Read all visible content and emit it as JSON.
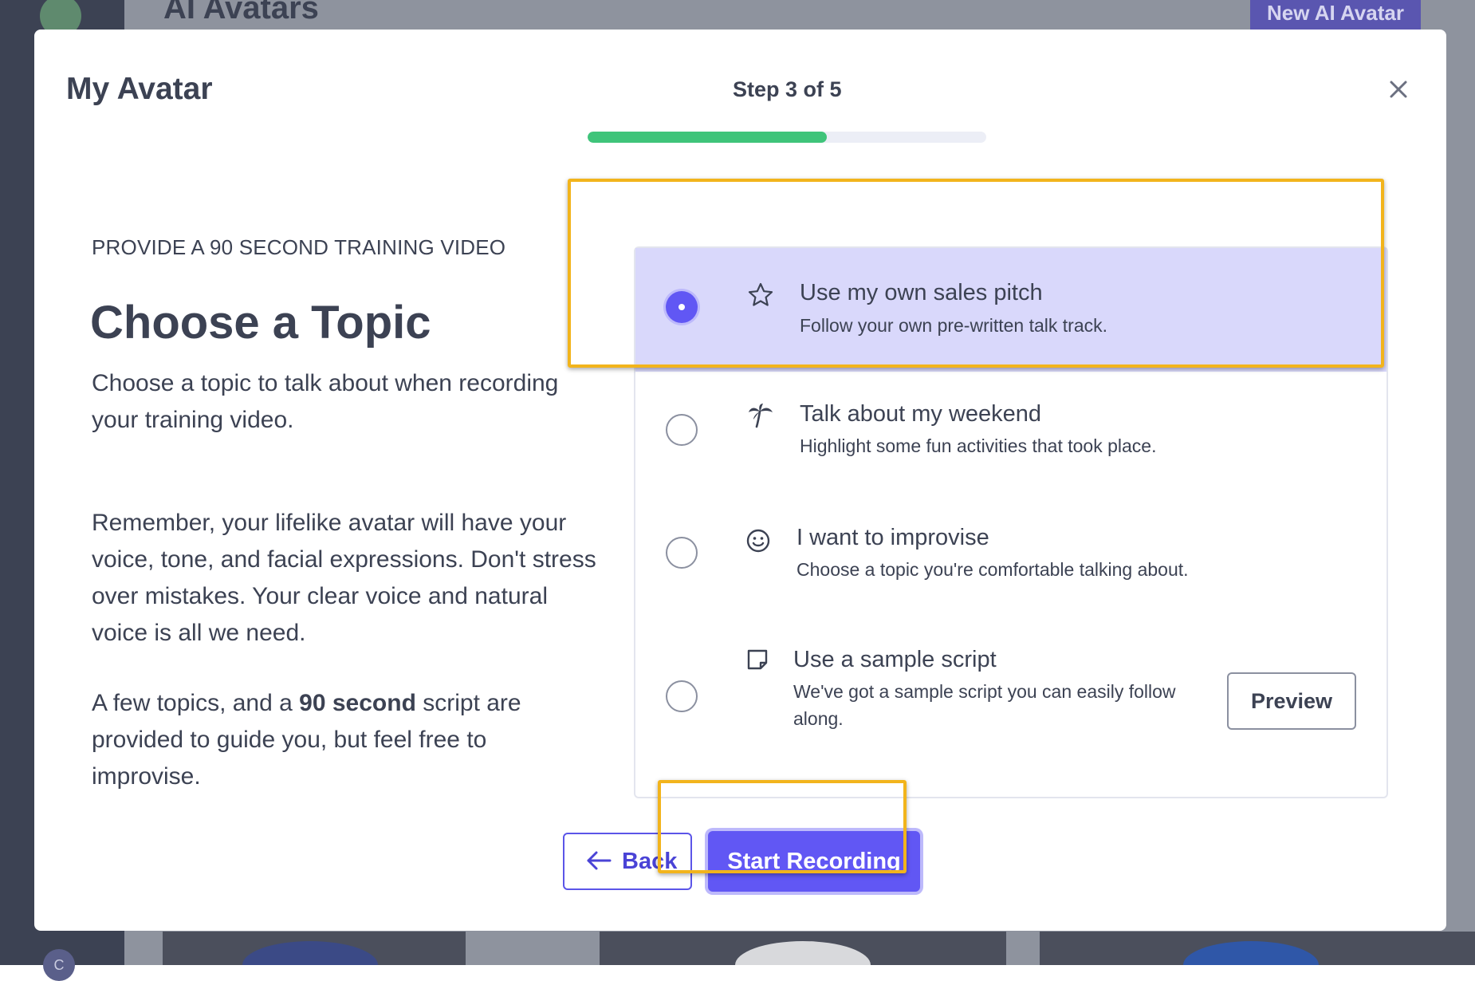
{
  "background_app": {
    "title": "AI Avatars",
    "new_button_label": "New AI Avatar",
    "sidebar_avatar_initial": "C"
  },
  "modal": {
    "title": "My Avatar",
    "step_label": "Step 3 of 5",
    "progress_fraction": 0.6,
    "close_icon": "close-icon"
  },
  "intro": {
    "eyebrow": "PROVIDE A 90 SECOND TRAINING VIDEO",
    "heading": "Choose a Topic",
    "paragraph1": "Choose a topic to talk about when recording your training video.",
    "paragraph2": "Remember, your lifelike avatar will have your voice, tone, and facial expressions. Don't stress over mistakes. Your clear voice and natural voice is all we need.",
    "paragraph3_before": "A few topics, and a ",
    "paragraph3_bold": "90 second",
    "paragraph3_after": " script are provided to guide you, but feel free to improvise."
  },
  "options": [
    {
      "title": "Use my own sales pitch",
      "description": "Follow your own pre-written talk track.",
      "icon": "star-icon",
      "selected": true
    },
    {
      "title": "Talk about my weekend",
      "description": "Highlight some fun activities that took place.",
      "icon": "palm-tree-icon",
      "selected": false
    },
    {
      "title": "I want to improvise",
      "description": "Choose a topic you're comfortable talking about.",
      "icon": "smiley-icon",
      "selected": false
    },
    {
      "title": "Use a sample script",
      "description": "We've got a sample script you can easily follow along.",
      "icon": "note-icon",
      "selected": false,
      "preview_label": "Preview"
    }
  ],
  "footer": {
    "back_label": "Back",
    "start_label": "Start Recording"
  },
  "colors": {
    "accent": "#6157f4",
    "progress": "#3fc47a",
    "selected_bg": "#d9d8fb",
    "highlight": "#f2b41c",
    "text": "#3c4253"
  }
}
